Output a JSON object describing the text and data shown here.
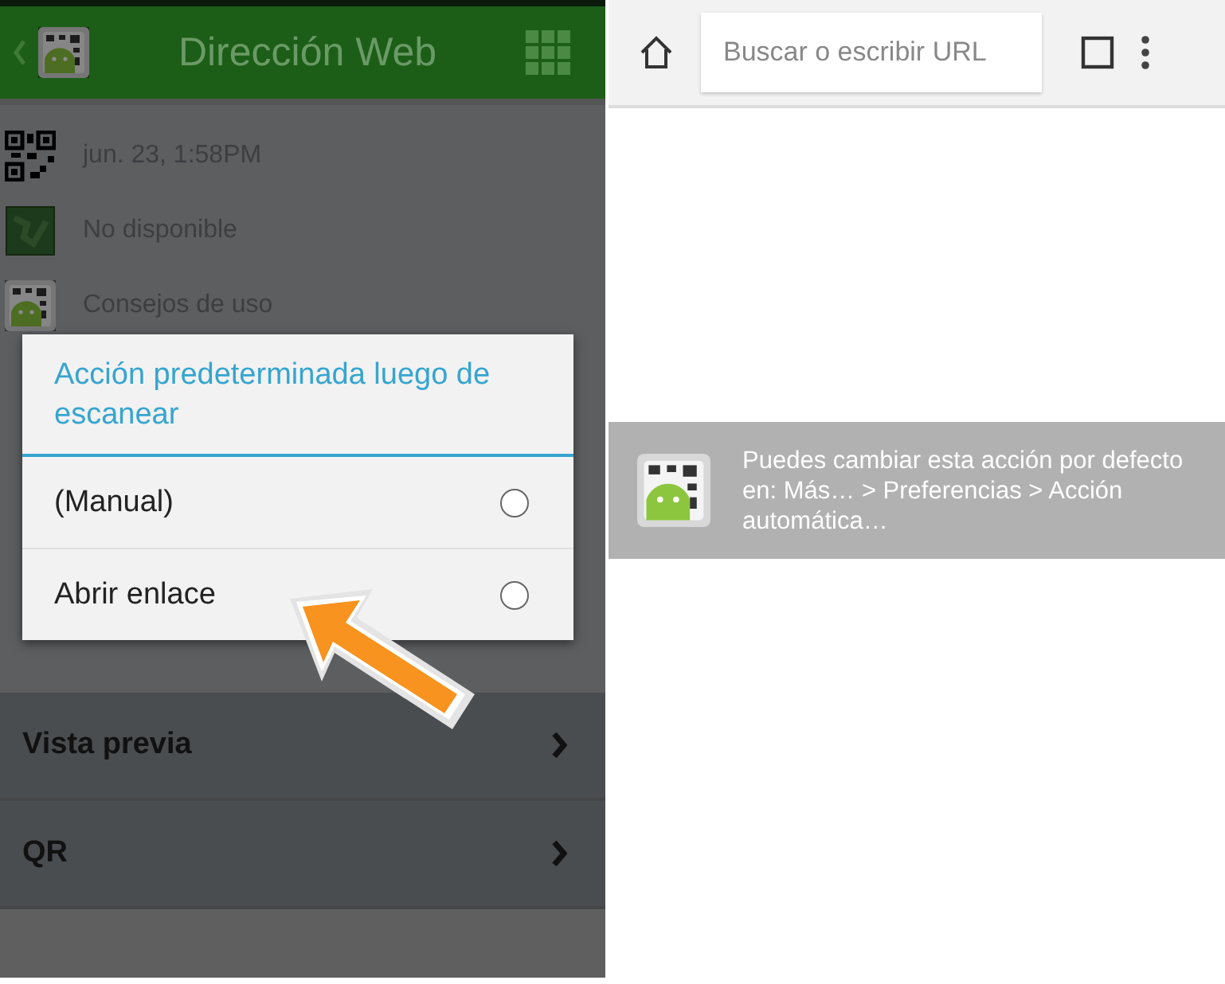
{
  "left": {
    "header": {
      "title": "Dirección Web"
    },
    "info_rows": [
      {
        "kind": "qr",
        "text": "jun. 23, 1:58PM"
      },
      {
        "kind": "map",
        "text": "No disponible"
      },
      {
        "kind": "app",
        "text": "Consejos de uso"
      }
    ],
    "dialog": {
      "title": "Acción predeterminada luego de escanear",
      "options": [
        {
          "label": "(Manual)",
          "selected": false
        },
        {
          "label": "Abrir enlace",
          "selected": false
        }
      ]
    },
    "sections": [
      {
        "label": "Vista previa"
      },
      {
        "label": "QR"
      }
    ]
  },
  "right": {
    "toolbar": {
      "placeholder": "Buscar o escribir URL"
    },
    "toast": {
      "text": "Puedes cambiar esta acción por defecto en: Más… > Preferencias > Acción automática…"
    }
  }
}
